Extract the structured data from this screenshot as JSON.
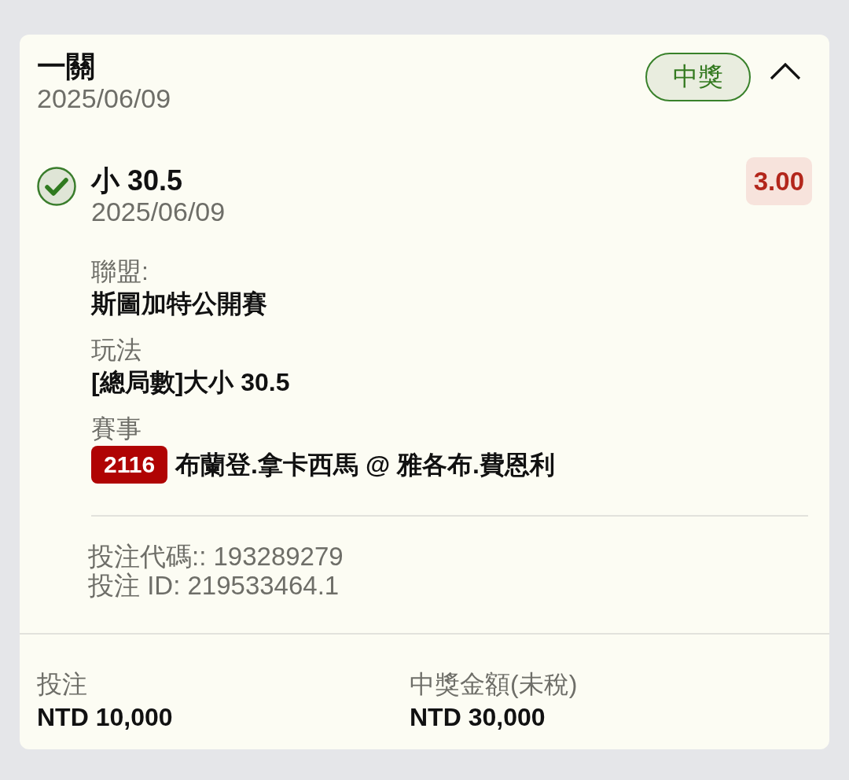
{
  "bet": {
    "type": "一關",
    "date": "2025/06/09",
    "status": {
      "label": "中獎",
      "kind": "won"
    },
    "expanded": true
  },
  "selections": [
    {
      "won": true,
      "pick": "小 30.5",
      "date": "2025/06/09",
      "odds": "3.00",
      "details": [
        {
          "kind": "text",
          "label": "聯盟:",
          "value": "斯圖加特公開賽"
        },
        {
          "kind": "text",
          "label": "玩法",
          "value": "[總局數]大小 30.5"
        },
        {
          "kind": "event",
          "label": "賽事",
          "event_code": "2116",
          "value": "布蘭登.拿卡西馬 @ 雅各布.費恩利"
        }
      ],
      "bet_code": "投注代碼:: 193289279",
      "bet_id": "投注 ID: 219533464.1"
    }
  ],
  "summary": [
    {
      "label": "投注",
      "value": "NTD 10,000"
    },
    {
      "label": "中獎金額(未稅)",
      "value": "NTD 30,000"
    }
  ]
}
